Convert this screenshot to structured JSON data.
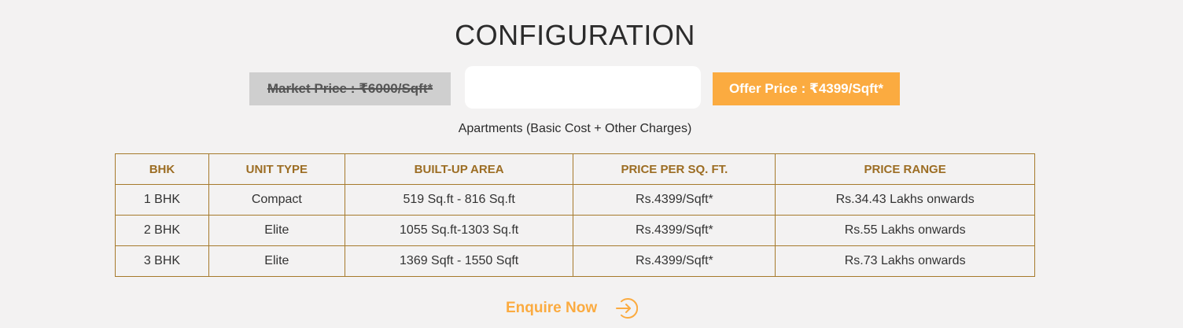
{
  "title": "CONFIGURATION",
  "market_price": "Market Price : ₹6000/Sqft*",
  "offer_price": "Offer Price : ₹4399/Sqft*",
  "subtitle": "Apartments (Basic Cost + Other Charges)",
  "table": {
    "headers": [
      "BHK",
      "UNIT TYPE",
      "BUILT-UP AREA",
      "PRICE PER SQ. FT.",
      "PRICE RANGE"
    ],
    "rows": [
      [
        "1 BHK",
        "Compact",
        "519 Sq.ft - 816 Sq.ft",
        "Rs.4399/Sqft*",
        "Rs.34.43 Lakhs onwards"
      ],
      [
        "2 BHK",
        "Elite",
        "1055 Sq.ft-1303 Sq.ft",
        "Rs.4399/Sqft*",
        "Rs.55 Lakhs onwards"
      ],
      [
        "3 BHK",
        "Elite",
        "1369 Sqft - 1550 Sqft",
        "Rs.4399/Sqft*",
        "Rs.73 Lakhs onwards"
      ]
    ]
  },
  "enquire_label": "Enquire Now",
  "enquire_icon": "arrow-right-circle-icon",
  "colors": {
    "accent": "#fbab40",
    "table_border": "#a67a2c",
    "header_text": "#9c6d23",
    "market_bg": "#cfcfcf",
    "page_bg": "#f3f2f2"
  }
}
